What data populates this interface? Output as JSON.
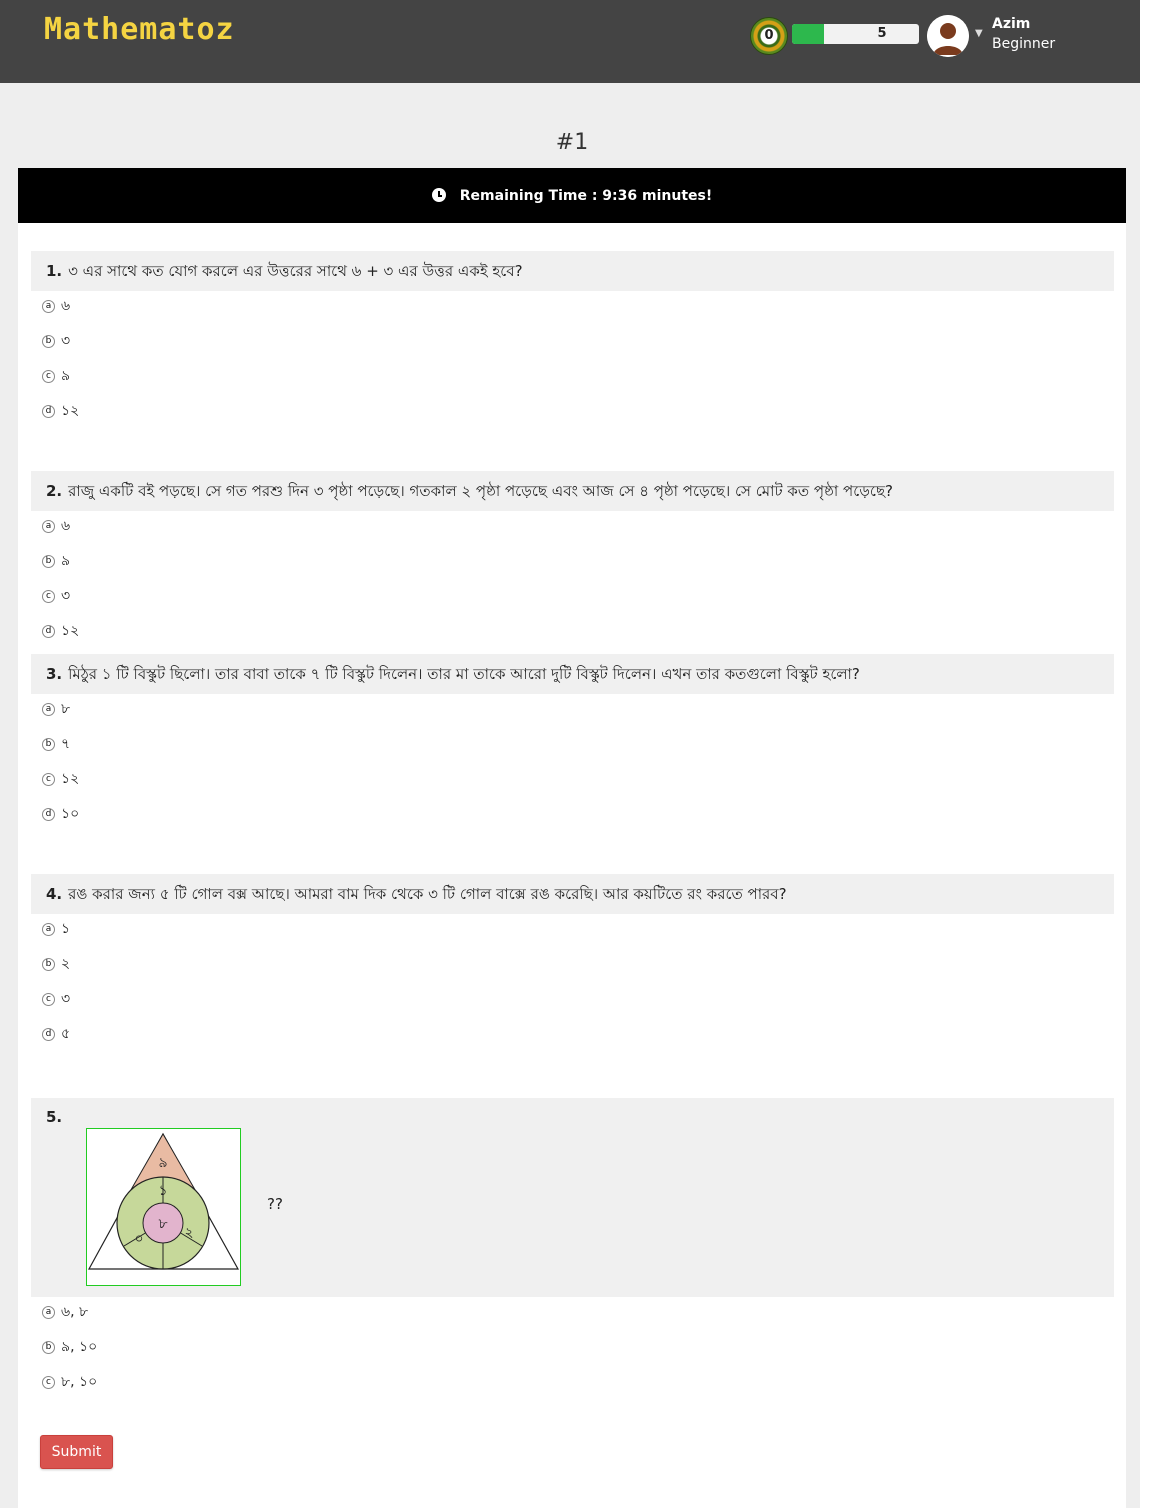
{
  "header": {
    "brand": "Mathematoz",
    "coin_count": "0",
    "xp_value": "5",
    "xp_progress_fraction": 0.25,
    "user_name": "Azim",
    "user_level": "Beginner"
  },
  "quiz": {
    "title": "#1",
    "timer_text": "Remaining Time : 9:36 minutes!",
    "submit_label": "Submit"
  },
  "questions": [
    {
      "number": "1.",
      "text": "৩ এর সাথে কত যোগ করলে এর উত্তরের সাথে ৬ + ৩ এর উত্তর একই হবে?",
      "options": [
        {
          "letter": "a",
          "text": "৬"
        },
        {
          "letter": "b",
          "text": "৩"
        },
        {
          "letter": "c",
          "text": "৯"
        },
        {
          "letter": "d",
          "text": "১২"
        }
      ]
    },
    {
      "number": "2.",
      "text": "রাজু একটি বই পড়ছে। সে গত পরশু দিন ৩ পৃষ্ঠা পড়েছে। গতকাল ২ পৃষ্ঠা পড়েছে এবং আজ সে ৪ পৃষ্ঠা পড়েছে। সে মোট কত পৃষ্ঠা পড়েছে?",
      "options": [
        {
          "letter": "a",
          "text": "৬"
        },
        {
          "letter": "b",
          "text": "৯"
        },
        {
          "letter": "c",
          "text": "৩"
        },
        {
          "letter": "d",
          "text": "১২"
        }
      ]
    },
    {
      "number": "3.",
      "text": "মিঠুর ১ টি বিস্কুট ছিলো। তার বাবা তাকে ৭ টি বিস্কুট দিলেন। তার মা তাকে আরো দুটি বিস্কুট দিলেন। এখন তার কতগুলো বিস্কুট হলো?",
      "options": [
        {
          "letter": "a",
          "text": "৮"
        },
        {
          "letter": "b",
          "text": "৭"
        },
        {
          "letter": "c",
          "text": "১২"
        },
        {
          "letter": "d",
          "text": "১০"
        }
      ]
    },
    {
      "number": "4.",
      "text": "রঙ করার জন্য ৫ টি গোল বক্স আছে। আমরা বাম দিক থেকে ৩ টি গোল বাক্সে রঙ করেছি। আর কয়টিতে রং করতে পারব?",
      "options": [
        {
          "letter": "a",
          "text": "১"
        },
        {
          "letter": "b",
          "text": "২"
        },
        {
          "letter": "c",
          "text": "৩"
        },
        {
          "letter": "d",
          "text": "৫"
        }
      ]
    },
    {
      "number": "5.",
      "text": "??",
      "figure": {
        "top_triangle": "৯",
        "segment_top": "১",
        "segment_left": "০",
        "segment_right": "২",
        "center": "৮"
      },
      "options": [
        {
          "letter": "a",
          "text": "৬, ৮"
        },
        {
          "letter": "b",
          "text": "৯, ১০"
        },
        {
          "letter": "c",
          "text": "৮, ১০"
        }
      ]
    }
  ],
  "colors": {
    "header_bg": "#444444",
    "brand": "#f5d442",
    "xp_fill": "#2db84d",
    "timer_bg": "#000000",
    "submit_bg": "#d9534f",
    "figure_border": "#22cc22",
    "figure_triangle": "#e9bba3",
    "figure_circle": "#c6d89a",
    "figure_center": "#e2b4cd"
  }
}
